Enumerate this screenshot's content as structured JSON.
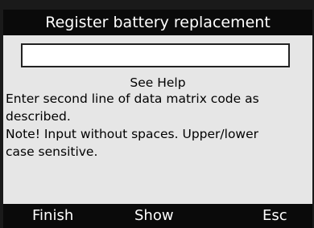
{
  "title": "Register battery replacement",
  "input": {
    "value": ""
  },
  "help": {
    "title": "See Help",
    "lines": [
      "Enter second line of data matrix code as",
      "described.",
      "Note! Input without spaces. Upper/lower",
      "case sensitive."
    ]
  },
  "softkeys": {
    "finish": "Finish",
    "show": "Show",
    "esc": "Esc"
  }
}
